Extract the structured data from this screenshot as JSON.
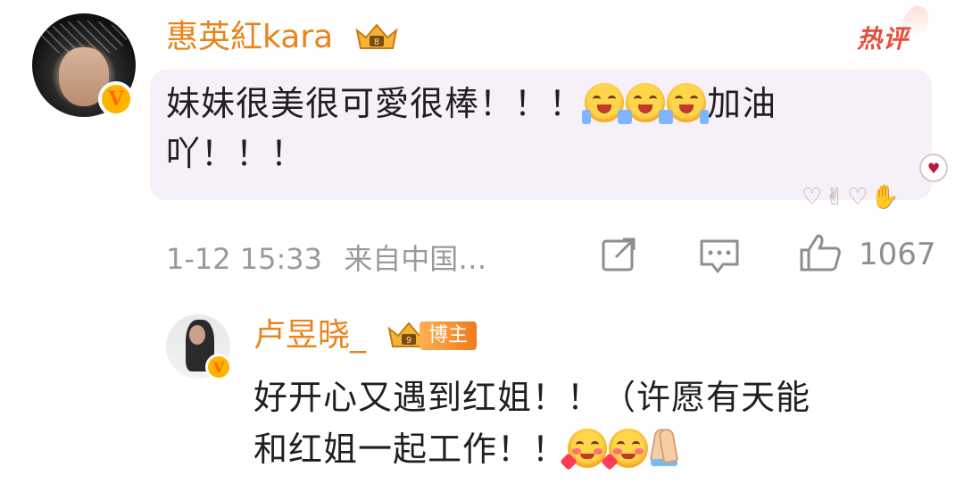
{
  "comment": {
    "username": "惠英紅kara",
    "hot_label": "热评",
    "text_line1": "妹妹很美很可愛很棒！！！",
    "text_after_emoji": "加油",
    "text_line2": "吖！！！",
    "timestamp": "1-12 15:33",
    "source": "来自中国…",
    "like_count": "1067",
    "emoji_names": [
      "cheer-emoji",
      "cheer-emoji",
      "cheer-emoji"
    ]
  },
  "reply": {
    "username": "卢昱晓_",
    "author_tag": "博主",
    "text_line1": "好开心又遇到红姐！！（许愿有天能",
    "text_line2": "和红姐一起工作！！",
    "emoji_names": [
      "love-emoji",
      "love-emoji",
      "pray-emoji"
    ]
  },
  "colors": {
    "username": "#e8841c",
    "bubble": "#f6f0f8",
    "hot": "#e6503a",
    "meta": "#9a9a9a"
  }
}
